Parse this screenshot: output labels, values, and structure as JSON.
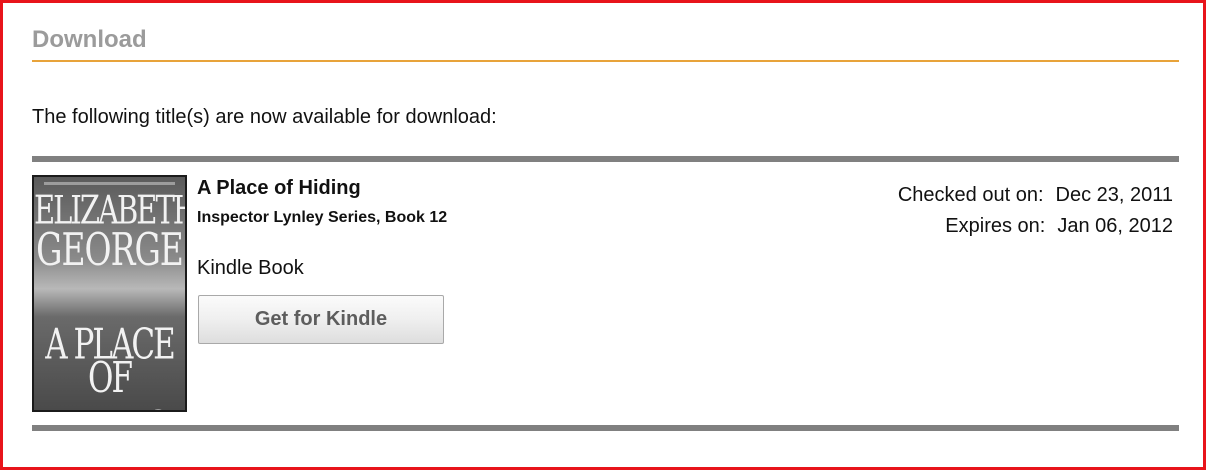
{
  "section": {
    "title": "Download",
    "intro": "The following title(s) are now available for download:"
  },
  "item": {
    "cover": {
      "author_line1": "ELIZABETH",
      "author_line2": "GEORGE",
      "title_line1": "A PLACE",
      "title_line2": "OF HIDING"
    },
    "title": "A Place of Hiding",
    "series": "Inspector Lynley Series, Book 12",
    "format": "Kindle Book",
    "button_label": "Get for Kindle",
    "checked_out_label": "Checked out on:",
    "checked_out_date": "Dec 23, 2011",
    "expires_label": "Expires on:",
    "expires_date": "Jan 06, 2012"
  },
  "colors": {
    "frame_border": "#e8141b",
    "title_rule": "#e8a33a",
    "section_title": "#9b9b9b",
    "divider": "#808080"
  }
}
